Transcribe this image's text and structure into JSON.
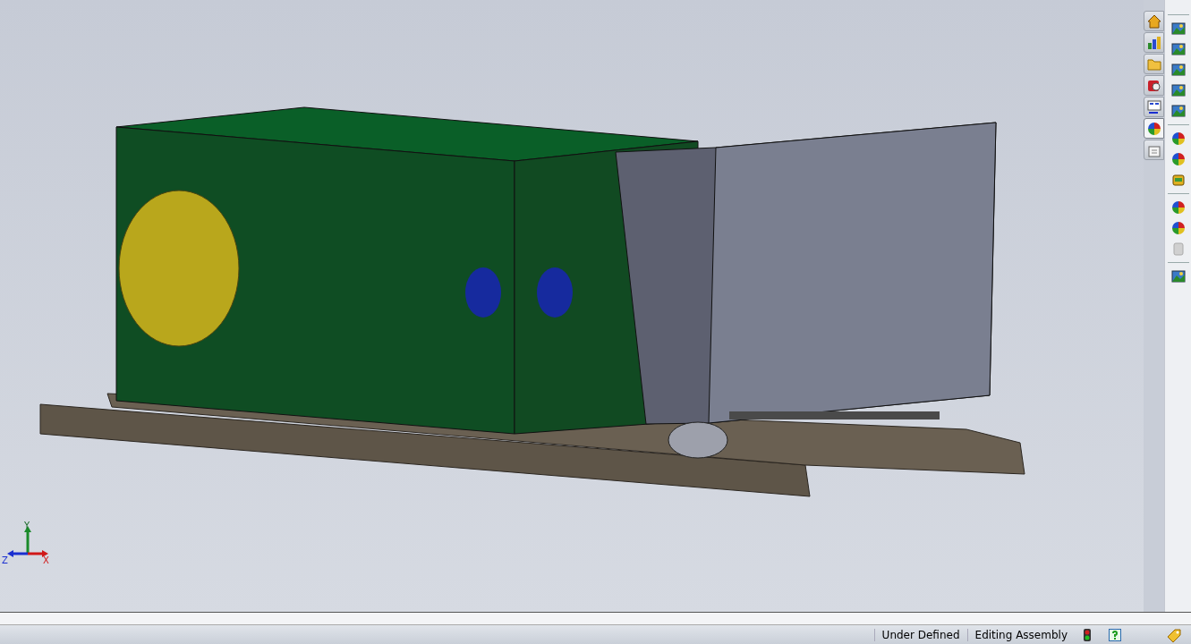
{
  "viewport": {
    "triad": {
      "y": "Y",
      "z": "Z",
      "x": "X"
    }
  },
  "task_pane_tabs": [
    {
      "kind": "home",
      "selected": false
    },
    {
      "kind": "library",
      "selected": false
    },
    {
      "kind": "folder",
      "selected": false
    },
    {
      "kind": "search",
      "selected": false
    },
    {
      "kind": "palette",
      "selected": false
    },
    {
      "kind": "appearance",
      "selected": true
    },
    {
      "kind": "properties",
      "selected": false
    }
  ],
  "status_bar": {
    "items": [
      "Under Defined",
      "Editing Assembly"
    ]
  }
}
